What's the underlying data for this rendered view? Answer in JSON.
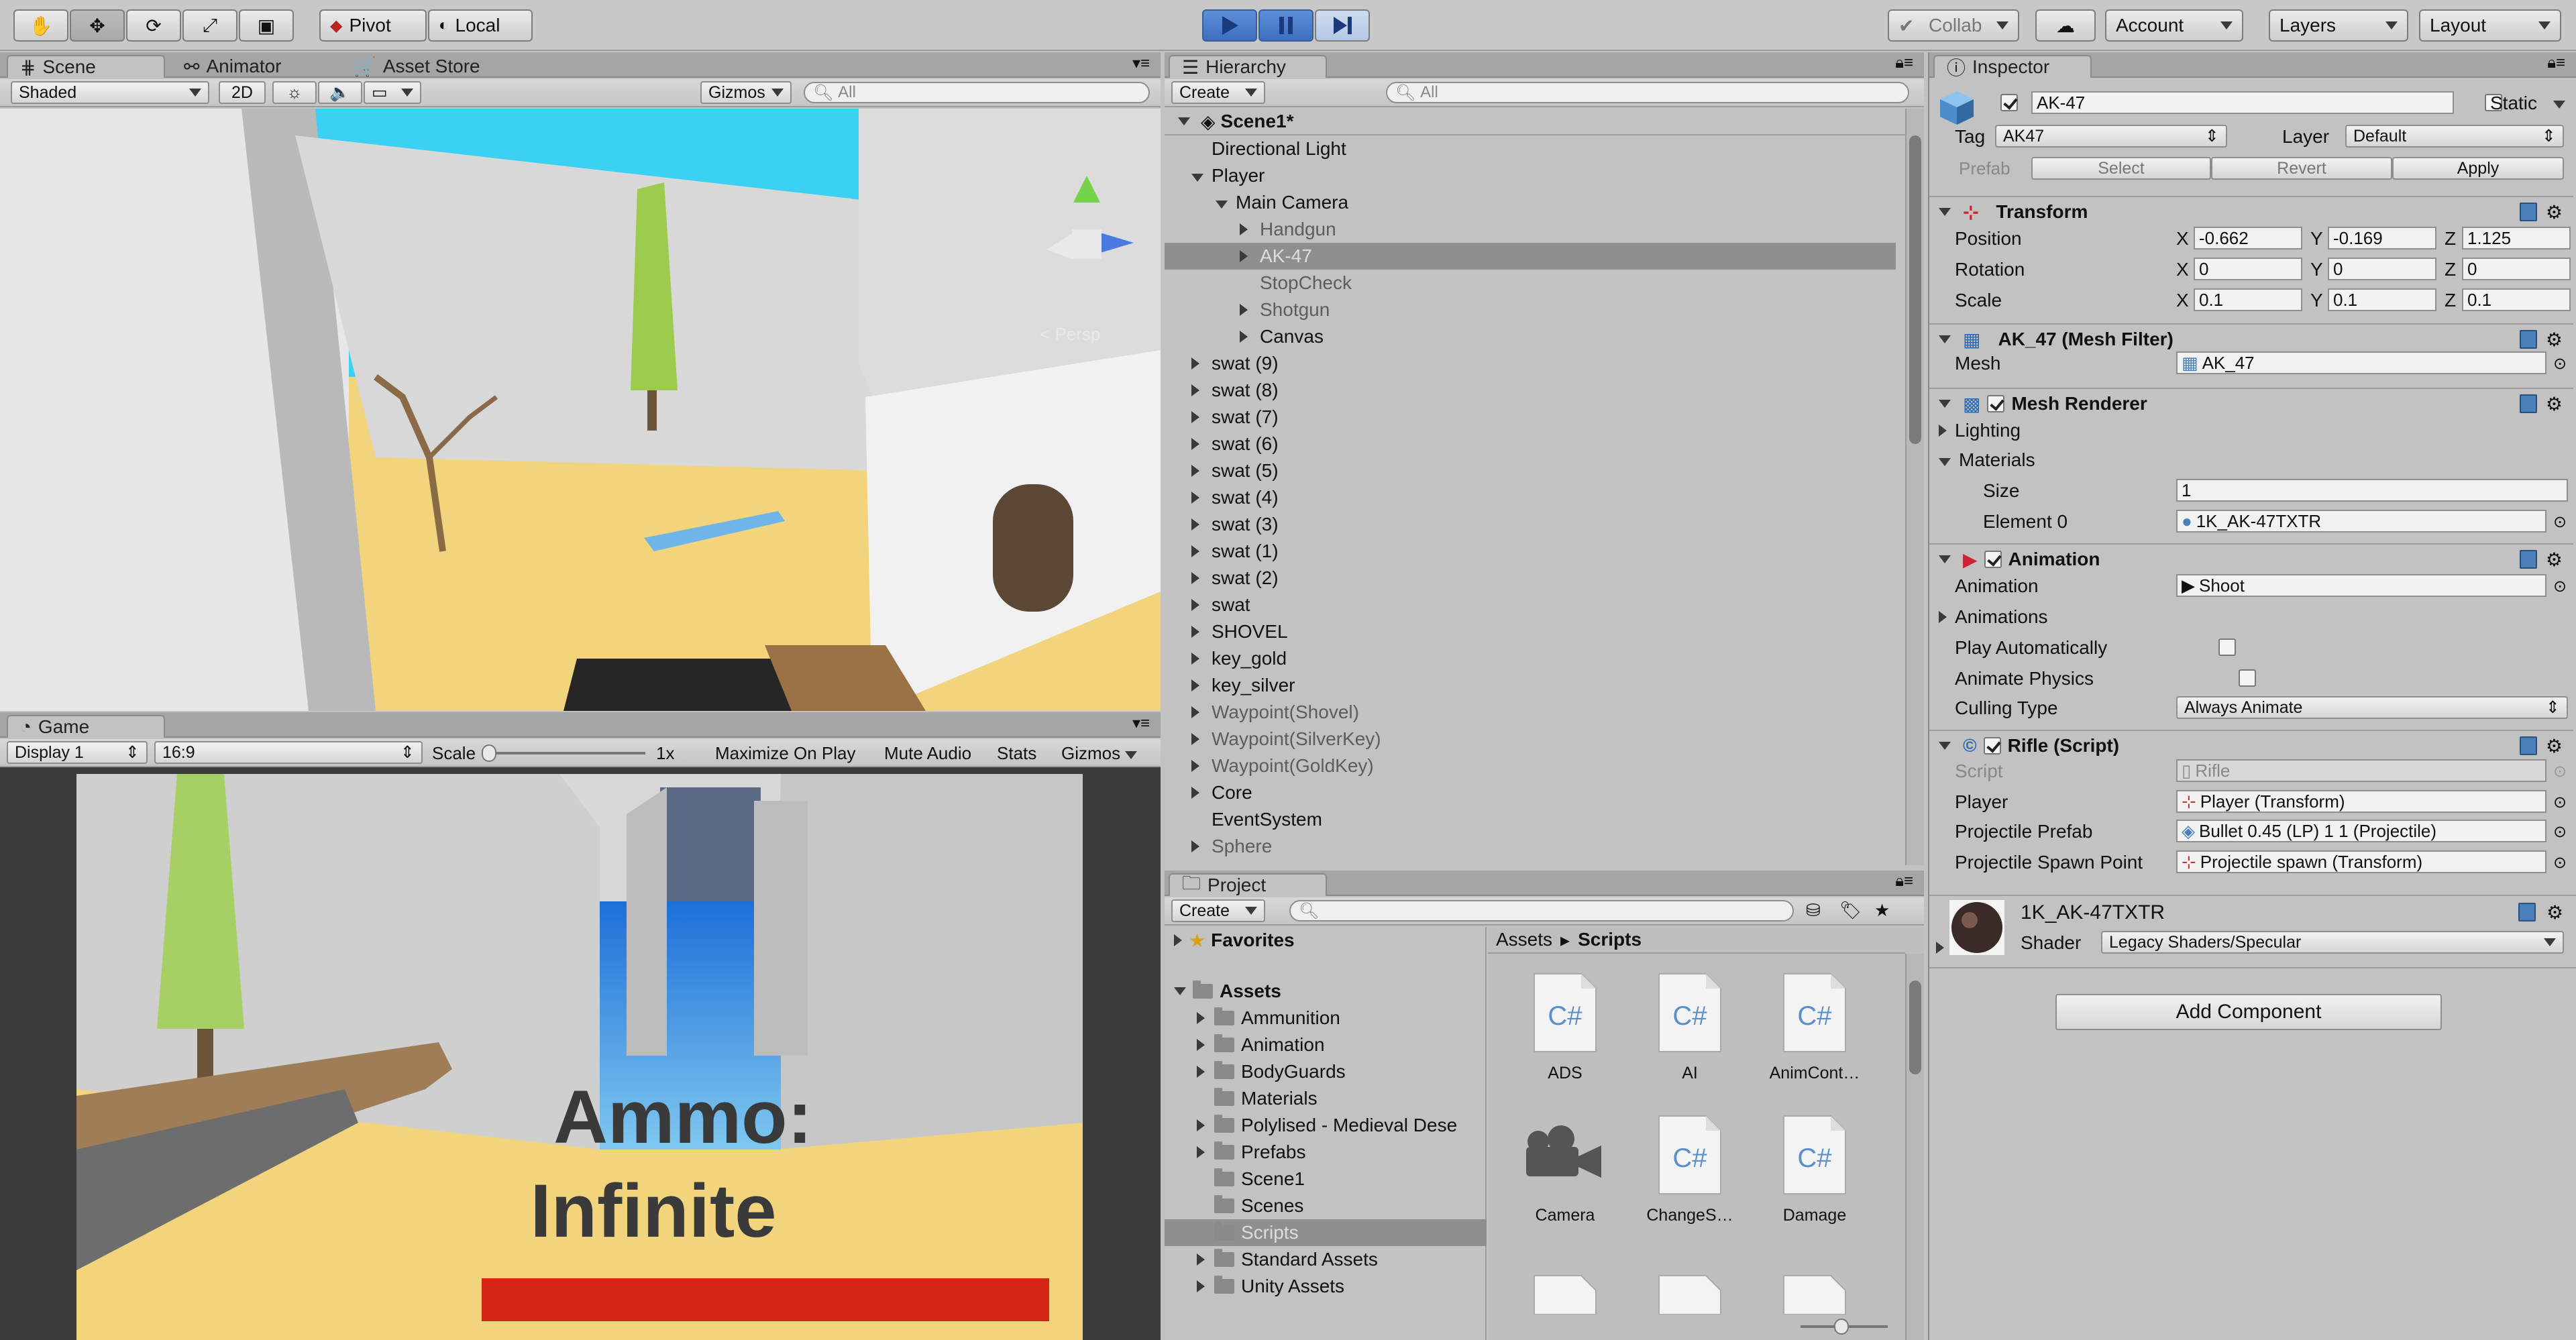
{
  "toolbar": {
    "pivot": "Pivot",
    "local": "Local",
    "collab": "Collab",
    "account": "Account",
    "layers": "Layers",
    "layout": "Layout"
  },
  "scene": {
    "tabs": [
      "Scene",
      "Animator",
      "Asset Store"
    ],
    "shading": "Shaded",
    "mode2d": "2D",
    "gizmos": "Gizmos",
    "search_placeholder": "All",
    "persp": "< Persp"
  },
  "game": {
    "tab": "Game",
    "display": "Display 1",
    "aspect": "16:9",
    "scale_label": "Scale",
    "scale_value": "1x",
    "maximize": "Maximize On Play",
    "mute": "Mute Audio",
    "stats": "Stats",
    "gizmos": "Gizmos",
    "hud_line1": "Ammo:",
    "hud_line2": "Infinite"
  },
  "hierarchy": {
    "tab": "Hierarchy",
    "create": "Create",
    "search_placeholder": "All",
    "scene_name": "Scene1*",
    "items": [
      {
        "label": "Directional Light",
        "indent": 0,
        "arrow": "",
        "style": "normal"
      },
      {
        "label": "Player",
        "indent": 0,
        "arrow": "down",
        "style": "normal"
      },
      {
        "label": "Main Camera",
        "indent": 1,
        "arrow": "down",
        "style": "normal"
      },
      {
        "label": "Handgun",
        "indent": 2,
        "arrow": "right",
        "style": "grey"
      },
      {
        "label": "AK-47",
        "indent": 2,
        "arrow": "right",
        "style": "selected"
      },
      {
        "label": "StopCheck",
        "indent": 2,
        "arrow": "",
        "style": "grey"
      },
      {
        "label": "Shotgun",
        "indent": 2,
        "arrow": "right",
        "style": "grey"
      },
      {
        "label": "Canvas",
        "indent": 2,
        "arrow": "right",
        "style": "normal"
      },
      {
        "label": "swat (9)",
        "indent": 0,
        "arrow": "right",
        "style": "normal"
      },
      {
        "label": "swat (8)",
        "indent": 0,
        "arrow": "right",
        "style": "normal"
      },
      {
        "label": "swat (7)",
        "indent": 0,
        "arrow": "right",
        "style": "normal"
      },
      {
        "label": "swat (6)",
        "indent": 0,
        "arrow": "right",
        "style": "normal"
      },
      {
        "label": "swat (5)",
        "indent": 0,
        "arrow": "right",
        "style": "normal"
      },
      {
        "label": "swat (4)",
        "indent": 0,
        "arrow": "right",
        "style": "normal"
      },
      {
        "label": "swat (3)",
        "indent": 0,
        "arrow": "right",
        "style": "normal"
      },
      {
        "label": "swat (1)",
        "indent": 0,
        "arrow": "right",
        "style": "normal"
      },
      {
        "label": "swat (2)",
        "indent": 0,
        "arrow": "right",
        "style": "normal"
      },
      {
        "label": "swat",
        "indent": 0,
        "arrow": "right",
        "style": "normal"
      },
      {
        "label": "SHOVEL",
        "indent": 0,
        "arrow": "right",
        "style": "normal"
      },
      {
        "label": "key_gold",
        "indent": 0,
        "arrow": "right",
        "style": "normal"
      },
      {
        "label": "key_silver",
        "indent": 0,
        "arrow": "right",
        "style": "normal"
      },
      {
        "label": "Waypoint(Shovel)",
        "indent": 0,
        "arrow": "right",
        "style": "grey"
      },
      {
        "label": "Waypoint(SilverKey)",
        "indent": 0,
        "arrow": "right",
        "style": "grey"
      },
      {
        "label": "Waypoint(GoldKey)",
        "indent": 0,
        "arrow": "right",
        "style": "grey"
      },
      {
        "label": "Core",
        "indent": 0,
        "arrow": "right",
        "style": "normal"
      },
      {
        "label": "EventSystem",
        "indent": 0,
        "arrow": "",
        "style": "normal"
      },
      {
        "label": "Sphere",
        "indent": 0,
        "arrow": "right",
        "style": "grey"
      }
    ]
  },
  "project": {
    "tab": "Project",
    "create": "Create",
    "favorites": "Favorites",
    "assets_root": "Assets",
    "folders": [
      {
        "label": "Ammunition",
        "arrow": "right",
        "style": "normal"
      },
      {
        "label": "Animation",
        "arrow": "right",
        "style": "normal"
      },
      {
        "label": "BodyGuards",
        "arrow": "right",
        "style": "normal"
      },
      {
        "label": "Materials",
        "arrow": "",
        "style": "normal"
      },
      {
        "label": "Polylised - Medieval Dese",
        "arrow": "right",
        "style": "normal"
      },
      {
        "label": "Prefabs",
        "arrow": "right",
        "style": "normal"
      },
      {
        "label": "Scene1",
        "arrow": "",
        "style": "normal"
      },
      {
        "label": "Scenes",
        "arrow": "",
        "style": "normal"
      },
      {
        "label": "Scripts",
        "arrow": "",
        "style": "selected"
      },
      {
        "label": "Standard Assets",
        "arrow": "right",
        "style": "normal"
      },
      {
        "label": "Unity Assets",
        "arrow": "right",
        "style": "normal"
      }
    ],
    "breadcrumb_root": "Assets",
    "breadcrumb_sep": "▸",
    "breadcrumb_current": "Scripts",
    "assets": [
      {
        "label": "ADS",
        "icon": "csharp-script-icon"
      },
      {
        "label": "AI",
        "icon": "csharp-script-icon"
      },
      {
        "label": "AnimCont…",
        "icon": "csharp-script-icon"
      },
      {
        "label": "Camera",
        "icon": "camera-icon"
      },
      {
        "label": "ChangeS…",
        "icon": "csharp-script-icon"
      },
      {
        "label": "Damage",
        "icon": "csharp-script-icon"
      }
    ],
    "csharp_glyph": "C#"
  },
  "inspector": {
    "tab": "Inspector",
    "object_name": "AK-47",
    "static_label": "Static",
    "tag_label": "Tag",
    "tag_value": "AK47",
    "layer_label": "Layer",
    "layer_value": "Default",
    "prefab_label": "Prefab",
    "prefab_select": "Select",
    "prefab_revert": "Revert",
    "prefab_apply": "Apply",
    "transform": {
      "title": "Transform",
      "rows": [
        {
          "label": "Position",
          "x": "-0.662",
          "y": "-0.169",
          "z": "1.125"
        },
        {
          "label": "Rotation",
          "x": "0",
          "y": "0",
          "z": "0"
        },
        {
          "label": "Scale",
          "x": "0.1",
          "y": "0.1",
          "z": "0.1"
        }
      ],
      "axis_x": "X",
      "axis_y": "Y",
      "axis_z": "Z"
    },
    "mesh_filter": {
      "title": "AK_47 (Mesh Filter)",
      "mesh_label": "Mesh",
      "mesh_value": "AK_47"
    },
    "mesh_renderer": {
      "title": "Mesh Renderer",
      "lighting": "Lighting",
      "materials": "Materials",
      "size_label": "Size",
      "size_value": "1",
      "element_label": "Element 0",
      "element_value": "1K_AK-47TXTR"
    },
    "animation": {
      "title": "Animation",
      "anim_label": "Animation",
      "anim_value": "Shoot",
      "anims_label": "Animations",
      "play_auto": "Play Automatically",
      "physics": "Animate Physics",
      "culling_label": "Culling Type",
      "culling_value": "Always Animate"
    },
    "rifle": {
      "title": "Rifle (Script)",
      "script_label": "Script",
      "script_value": "Rifle",
      "player_label": "Player",
      "player_value": "Player (Transform)",
      "prefab_label": "Projectile Prefab",
      "prefab_value": "Bullet 0.45 (LP) 1 1 (Projectile)",
      "spawn_label": "Projectile Spawn Point",
      "spawn_value": "Projectile spawn (Transform)"
    },
    "material": {
      "name": "1K_AK-47TXTR",
      "shader_label": "Shader",
      "shader_value": "Legacy Shaders/Specular"
    },
    "add_component": "Add Component"
  },
  "colors": {
    "panel_bg": "#c2c2c2",
    "tab_bar": "#a5a5a5",
    "selection": "#8f8f8f",
    "hud_bar": "#d32414",
    "play_blue": "#3d6fc0",
    "sand": "#f2d47d",
    "sky": "#3ad1f2"
  }
}
